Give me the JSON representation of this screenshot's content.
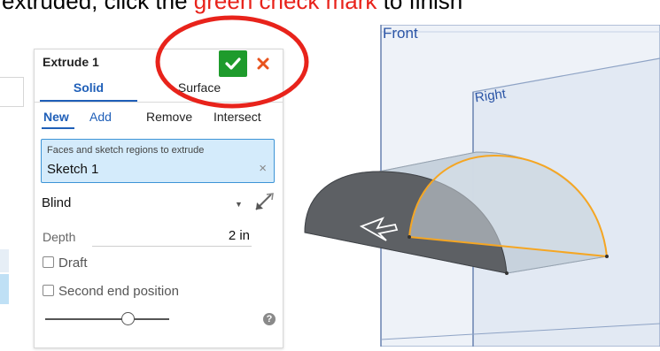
{
  "instruction": {
    "before": "extruded, click the ",
    "highlight": "green check mark",
    "after": " to finish"
  },
  "dialog": {
    "title": "Extrude 1",
    "accept_icon": "checkmark-icon",
    "cancel_icon": "close-icon",
    "tabs": {
      "solid": "Solid",
      "surface": "Surface",
      "selected": "Solid"
    },
    "operations": {
      "new": "New",
      "add": "Add",
      "remove": "Remove",
      "intersect": "Intersect",
      "selected": "New"
    },
    "selection": {
      "label": "Faces and sketch regions to extrude",
      "value": "Sketch 1",
      "clear": "×"
    },
    "end_type": {
      "value": "Blind",
      "arrow": "▼"
    },
    "depth": {
      "label": "Depth",
      "value": "2 in"
    },
    "draft": {
      "label": "Draft",
      "checked": false
    },
    "second_end": {
      "label": "Second end position",
      "checked": false
    },
    "help": "?"
  },
  "viewport": {
    "front_label": "Front",
    "right_label": "Right"
  },
  "colors": {
    "accept_green": "#1e9b2c",
    "cancel_orange": "#e8531d",
    "active_blue": "#1f5fb8",
    "highlight_red": "#e8231b",
    "selection_bg": "#d4ebfb",
    "edge_orange": "#f5a623"
  }
}
